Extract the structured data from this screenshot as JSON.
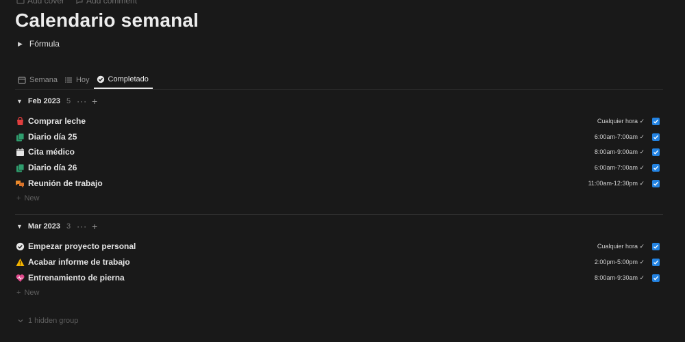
{
  "topbar": {
    "add_cover": "Add cover",
    "add_comment": "Add comment"
  },
  "page": {
    "title": "Calendario semanal"
  },
  "toggle": {
    "label": "Fórmula"
  },
  "tabs": [
    {
      "label": "Semana",
      "icon": "calendar-icon"
    },
    {
      "label": "Hoy",
      "icon": "list-icon"
    },
    {
      "label": "Completado",
      "icon": "check-circle-icon"
    }
  ],
  "groups": [
    {
      "name": "Feb 2023",
      "count": "5",
      "items": [
        {
          "name": "Comprar leche",
          "icon": "shopping-bag-icon",
          "time": "Cualquier hora ✓",
          "done": true
        },
        {
          "name": "Diario día 25",
          "icon": "journal-icon",
          "time": "6:00am-7:00am ✓",
          "done": true
        },
        {
          "name": "Cita médico",
          "icon": "calendar-day-icon",
          "time": "8:00am-9:00am ✓",
          "done": true
        },
        {
          "name": "Diario día 26",
          "icon": "journal-icon",
          "time": "6:00am-7:00am ✓",
          "done": true
        },
        {
          "name": "Reunión de trabajo",
          "icon": "chat-bubbles-icon",
          "time": "11:00am-12:30pm ✓",
          "done": true
        }
      ],
      "new_label": "New"
    },
    {
      "name": "Mar 2023",
      "count": "3",
      "items": [
        {
          "name": "Empezar proyecto personal",
          "icon": "check-circle-icon",
          "time": "Cualquier hora ✓",
          "done": true
        },
        {
          "name": "Acabar informe de trabajo",
          "icon": "warning-icon",
          "time": "2:00pm-5:00pm ✓",
          "done": true
        },
        {
          "name": "Entrenamiento de pierna",
          "icon": "heart-pulse-icon",
          "time": "8:00am-9:30am ✓",
          "done": true
        }
      ],
      "new_label": "New"
    }
  ],
  "hidden_groups": {
    "label": "1 hidden group"
  },
  "colors": {
    "background": "#191919",
    "checkbox": "#2383e2",
    "shopping_bag": "#e03e3e",
    "journal": "#2f9e6e",
    "chat": "#e8892b",
    "warning": "#f5b400",
    "heart": "#e0488b"
  }
}
